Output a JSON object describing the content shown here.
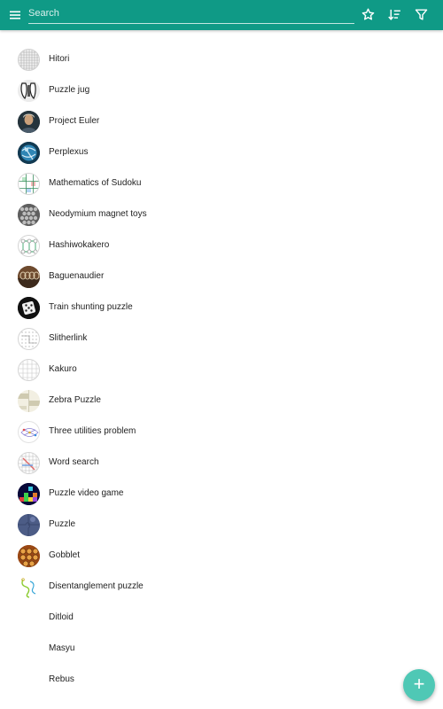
{
  "app": {
    "accent": "#0f9a86",
    "fab_color": "#4fc8b5"
  },
  "toolbar": {
    "menu_icon": "menu-icon",
    "search_placeholder": "Search",
    "search_value": "",
    "favorite_icon": "star-outline-icon",
    "sort_icon": "sort-icon",
    "filter_icon": "filter-icon"
  },
  "items": [
    {
      "label": "Hitori",
      "icon": "grid"
    },
    {
      "label": "Puzzle jug",
      "icon": "jug"
    },
    {
      "label": "Project Euler",
      "icon": "portrait"
    },
    {
      "label": "Perplexus",
      "icon": "sphere"
    },
    {
      "label": "Mathematics of Sudoku",
      "icon": "sudoku"
    },
    {
      "label": "Neodymium magnet toys",
      "icon": "magnets"
    },
    {
      "label": "Hashiwokakero",
      "icon": "bridges"
    },
    {
      "label": "Baguenaudier",
      "icon": "rings"
    },
    {
      "label": "Train shunting puzzle",
      "icon": "dice"
    },
    {
      "label": "Slitherlink",
      "icon": "dots"
    },
    {
      "label": "Kakuro",
      "icon": "grid-light"
    },
    {
      "label": "Zebra Puzzle",
      "icon": "zebra"
    },
    {
      "label": "Three utilities problem",
      "icon": "graph"
    },
    {
      "label": "Word search",
      "icon": "wordsearch"
    },
    {
      "label": "Puzzle video game",
      "icon": "tetris"
    },
    {
      "label": "Puzzle",
      "icon": "jigsaw"
    },
    {
      "label": "Gobblet",
      "icon": "gobblet"
    },
    {
      "label": "Disentanglement puzzle",
      "icon": "wire"
    },
    {
      "label": "Ditloid",
      "icon": "none"
    },
    {
      "label": "Masyu",
      "icon": "none"
    },
    {
      "label": "Rebus",
      "icon": "none"
    }
  ],
  "fab": {
    "label": "+",
    "icon": "add-icon"
  }
}
